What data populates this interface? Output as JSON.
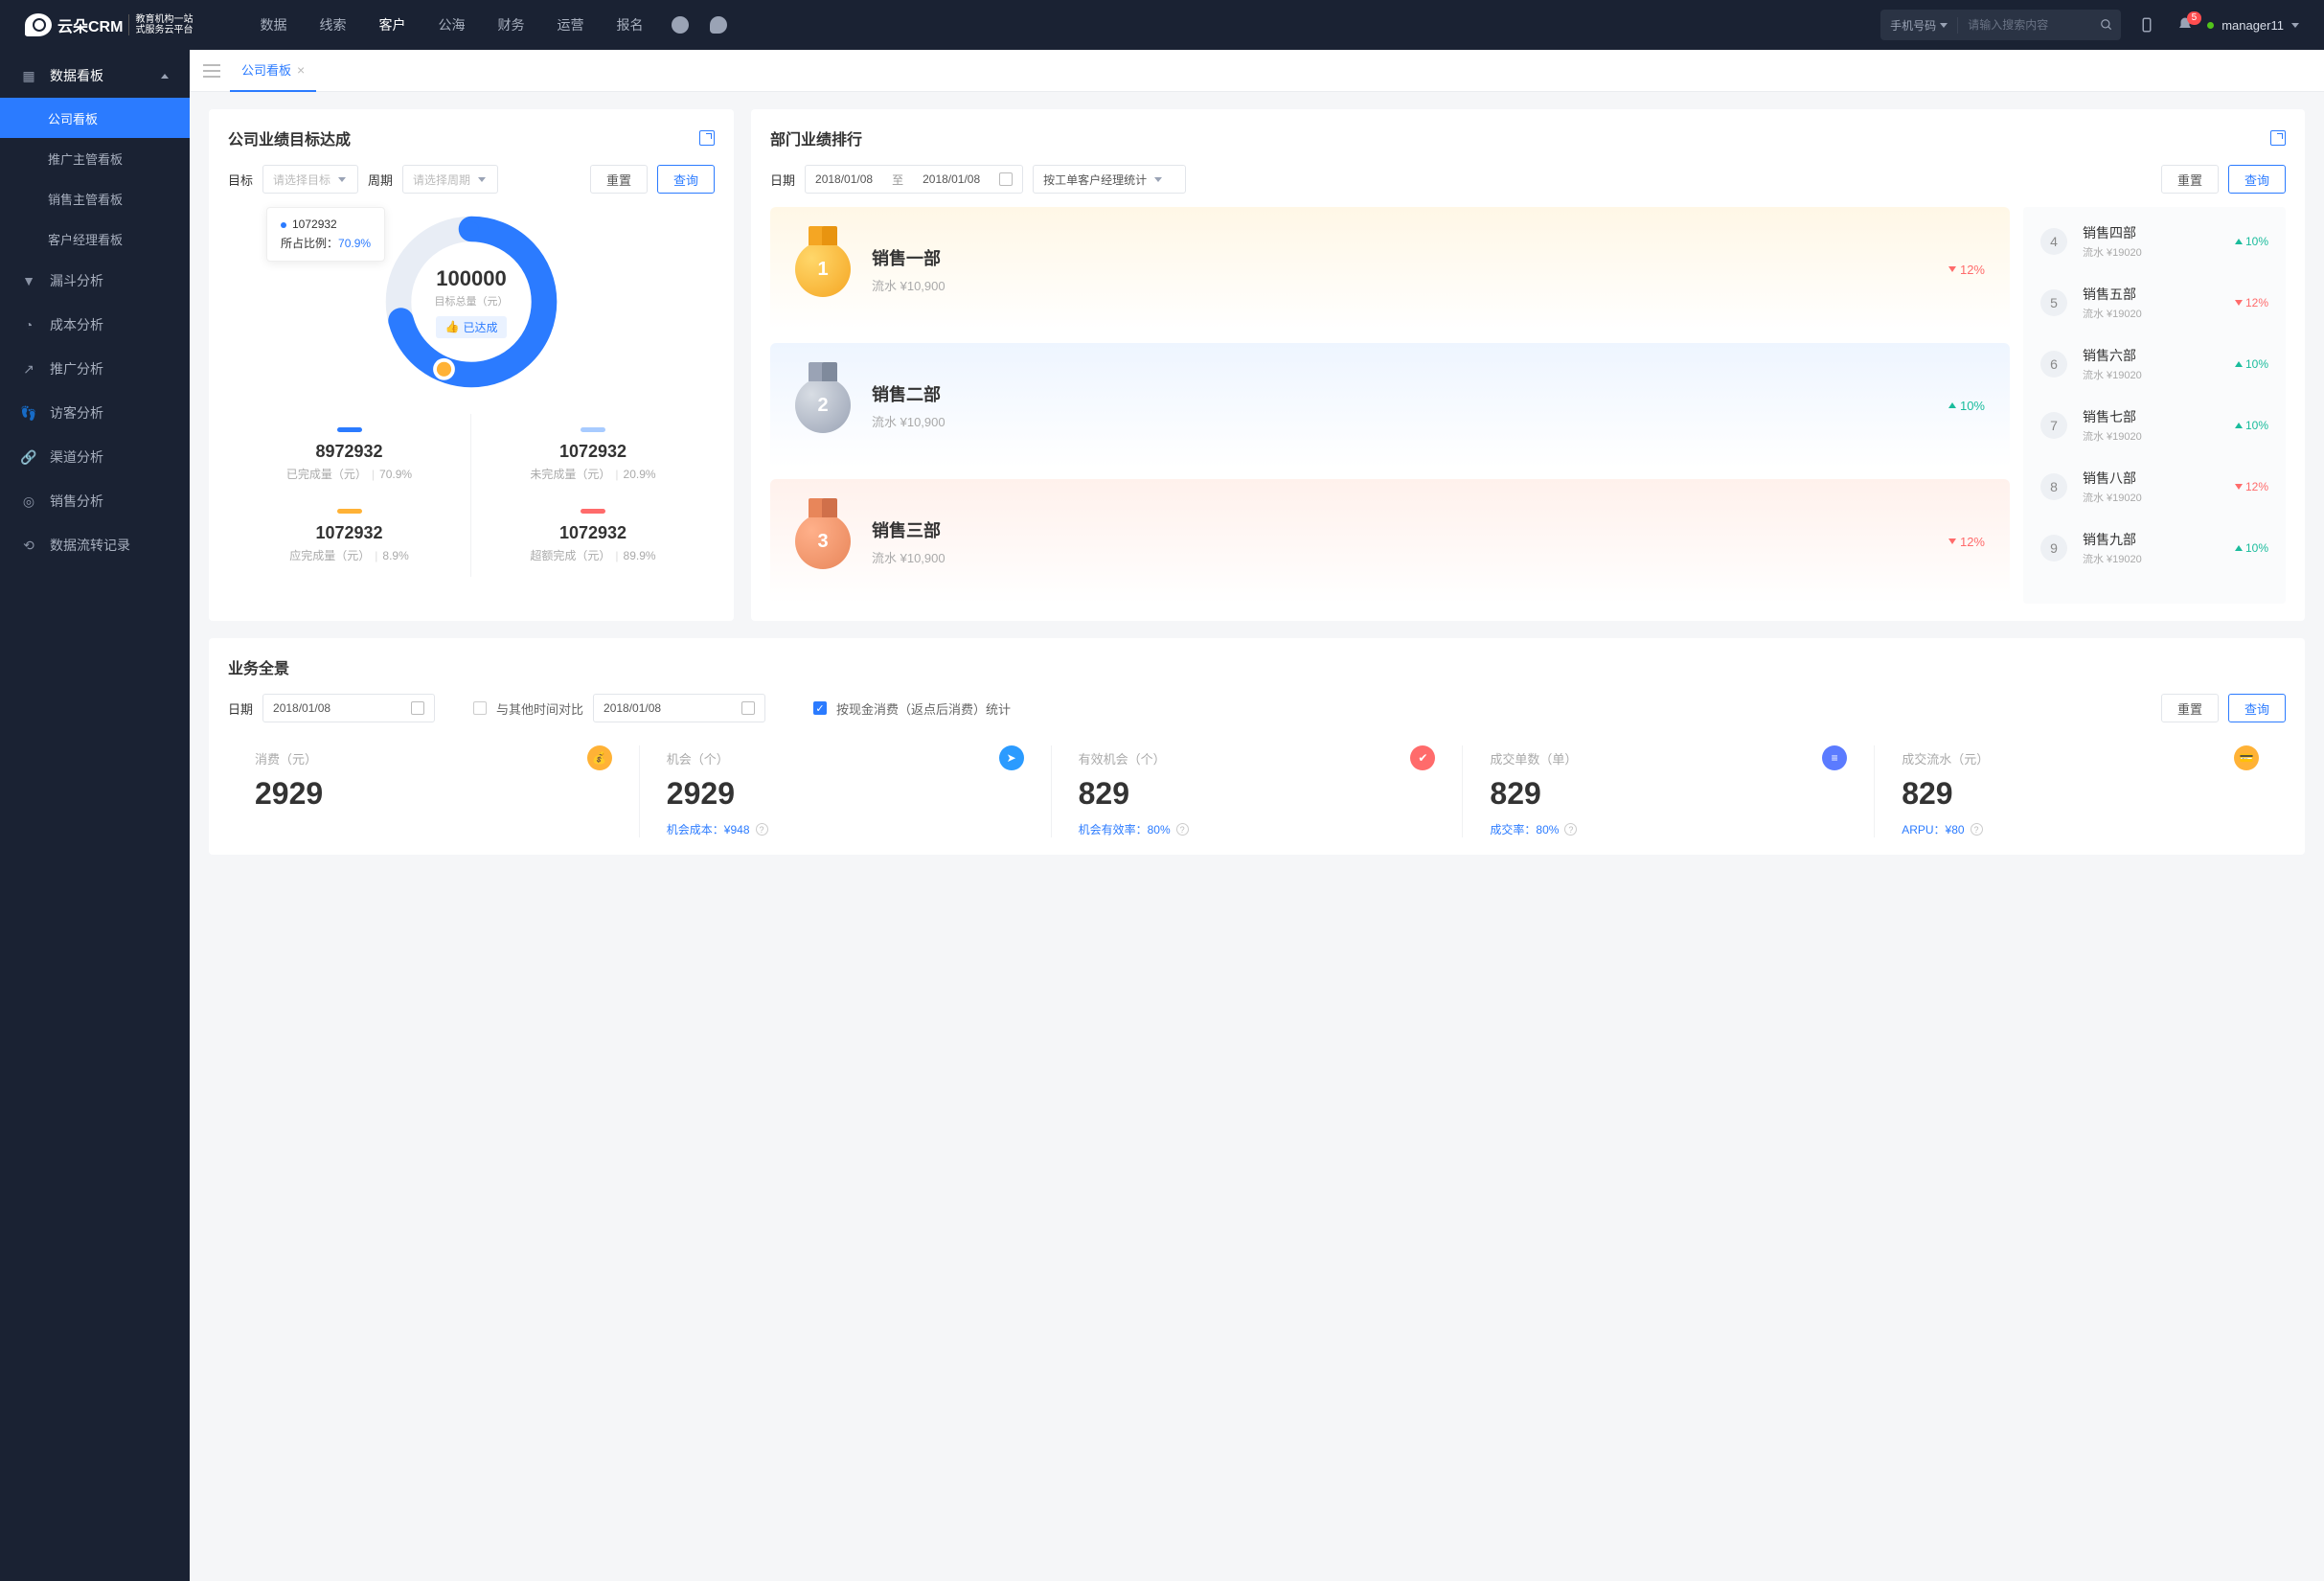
{
  "brand": {
    "name": "云朵CRM",
    "sub1": "教育机构一站",
    "sub2": "式服务云平台"
  },
  "topnav": [
    "数据",
    "线索",
    "客户",
    "公海",
    "财务",
    "运营",
    "报名"
  ],
  "topnav_active_index": 2,
  "search": {
    "type": "手机号码",
    "placeholder": "请输入搜索内容"
  },
  "notif_count": "5",
  "user": "manager11",
  "sidebar": {
    "group": "数据看板",
    "subs": [
      "公司看板",
      "推广主管看板",
      "销售主管看板",
      "客户经理看板"
    ],
    "active_sub_index": 0,
    "items": [
      "漏斗分析",
      "成本分析",
      "推广分析",
      "访客分析",
      "渠道分析",
      "销售分析",
      "数据流转记录"
    ]
  },
  "tab": {
    "label": "公司看板"
  },
  "card_a": {
    "title": "公司业绩目标达成",
    "filters": {
      "goal_label": "目标",
      "goal_ph": "请选择目标",
      "period_label": "周期",
      "period_ph": "请选择周期",
      "reset": "重置",
      "query": "查询"
    },
    "donut": {
      "value": "100000",
      "label": "目标总量（元）",
      "badge": "已达成"
    },
    "tooltip": {
      "val": "1072932",
      "pct_label": "所占比例：",
      "pct": "70.9%"
    },
    "stats": [
      {
        "bar": "#2b7bff",
        "val": "8972932",
        "lbl": "已完成量（元）",
        "pct": "70.9%"
      },
      {
        "bar": "#a8cbff",
        "val": "1072932",
        "lbl": "未完成量（元）",
        "pct": "20.9%"
      },
      {
        "bar": "#ffb236",
        "val": "1072932",
        "lbl": "应完成量（元）",
        "pct": "8.9%"
      },
      {
        "bar": "#ff6b6b",
        "val": "1072932",
        "lbl": "超额完成（元）",
        "pct": "89.9%"
      }
    ]
  },
  "card_b": {
    "title": "部门业绩排行",
    "filters": {
      "date_label": "日期",
      "from": "2018/01/08",
      "to_sep": "至",
      "to": "2018/01/08",
      "stat_by": "按工单客户经理统计",
      "reset": "重置",
      "query": "查询"
    },
    "top3": [
      {
        "name": "销售一部",
        "flow": "流水 ¥10,900",
        "pct": "12%",
        "dir": "down"
      },
      {
        "name": "销售二部",
        "flow": "流水 ¥10,900",
        "pct": "10%",
        "dir": "up"
      },
      {
        "name": "销售三部",
        "flow": "流水 ¥10,900",
        "pct": "12%",
        "dir": "down"
      }
    ],
    "rest": [
      {
        "rank": "4",
        "name": "销售四部",
        "flow": "流水 ¥19020",
        "pct": "10%",
        "dir": "up"
      },
      {
        "rank": "5",
        "name": "销售五部",
        "flow": "流水 ¥19020",
        "pct": "12%",
        "dir": "down"
      },
      {
        "rank": "6",
        "name": "销售六部",
        "flow": "流水 ¥19020",
        "pct": "10%",
        "dir": "up"
      },
      {
        "rank": "7",
        "name": "销售七部",
        "flow": "流水 ¥19020",
        "pct": "10%",
        "dir": "up"
      },
      {
        "rank": "8",
        "name": "销售八部",
        "flow": "流水 ¥19020",
        "pct": "12%",
        "dir": "down"
      },
      {
        "rank": "9",
        "name": "销售九部",
        "flow": "流水 ¥19020",
        "pct": "10%",
        "dir": "up"
      }
    ]
  },
  "card_c": {
    "title": "业务全景",
    "filters": {
      "date_label": "日期",
      "date": "2018/01/08",
      "compare_label": "与其他时间对比",
      "date2": "2018/01/08",
      "check_label": "按现金消费（返点后消费）统计",
      "reset": "重置",
      "query": "查询"
    },
    "items": [
      {
        "lbl": "消费（元）",
        "val": "2929",
        "foot_lbl": "",
        "foot_val": "",
        "icon_bg": "#ffb236",
        "glyph": "💰"
      },
      {
        "lbl": "机会（个）",
        "val": "2929",
        "foot_lbl": "机会成本：",
        "foot_val": "¥948",
        "icon_bg": "#2b9bff",
        "glyph": "➤"
      },
      {
        "lbl": "有效机会（个）",
        "val": "829",
        "foot_lbl": "机会有效率：",
        "foot_val": "80%",
        "icon_bg": "#ff6b6b",
        "glyph": "✔"
      },
      {
        "lbl": "成交单数（单）",
        "val": "829",
        "foot_lbl": "成交率：",
        "foot_val": "80%",
        "icon_bg": "#5b7bff",
        "glyph": "≡"
      },
      {
        "lbl": "成交流水（元）",
        "val": "829",
        "foot_lbl": "ARPU：",
        "foot_val": "¥80",
        "icon_bg": "#ffb236",
        "glyph": "💳"
      }
    ]
  },
  "chart_data": {
    "type": "pie",
    "title": "公司业绩目标达成",
    "total_label": "目标总量（元）",
    "total": 100000,
    "series": [
      {
        "name": "已完成量（元）",
        "value": 8972932,
        "pct": 70.9,
        "color": "#2b7bff"
      },
      {
        "name": "未完成量（元）",
        "value": 1072932,
        "pct": 20.9,
        "color": "#a8cbff"
      },
      {
        "name": "应完成量（元）",
        "value": 1072932,
        "pct": 8.9,
        "color": "#ffb236"
      },
      {
        "name": "超额完成（元）",
        "value": 1072932,
        "pct": 89.9,
        "color": "#ff6b6b"
      }
    ],
    "tooltip": {
      "value": 1072932,
      "pct": 70.9
    }
  }
}
